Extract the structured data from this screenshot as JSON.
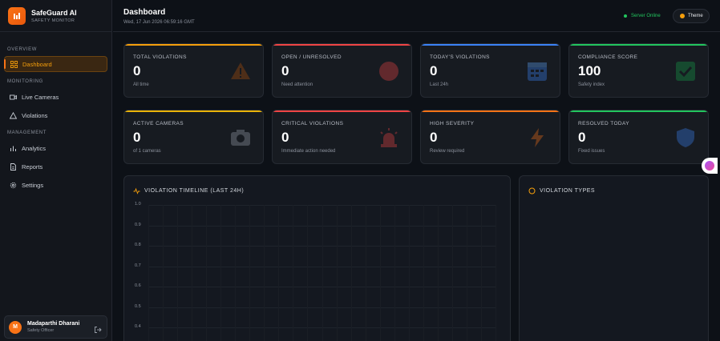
{
  "brand": {
    "name": "SafeGuard AI",
    "subtitle": "SAFETY MONITOR"
  },
  "sidebar": {
    "sections": {
      "overview": "OVERVIEW",
      "monitoring": "MONITORING",
      "management": "MANAGEMENT"
    },
    "items": [
      {
        "label": "Dashboard",
        "icon": "grid-icon",
        "active": true
      },
      {
        "label": "Live Cameras",
        "icon": "video-icon"
      },
      {
        "label": "Violations",
        "icon": "warning-icon"
      },
      {
        "label": "Analytics",
        "icon": "bar-chart-icon"
      },
      {
        "label": "Reports",
        "icon": "document-icon"
      },
      {
        "label": "Settings",
        "icon": "gear-icon"
      }
    ]
  },
  "user": {
    "initial": "M",
    "name": "Madaparthi Dharani",
    "role": "Safety Officer"
  },
  "header": {
    "title": "Dashboard",
    "date": "Wed, 17 Jun 2026 06:59:16 GMT",
    "server_status": "Server Online",
    "theme_label": "Theme"
  },
  "stats": [
    {
      "label": "TOTAL VIOLATIONS",
      "value": "0",
      "sub": "All time",
      "accent": "#f59e0b",
      "icon": "warning-icon"
    },
    {
      "label": "OPEN / UNRESOLVED",
      "value": "0",
      "sub": "Need attention",
      "accent": "#ef4444",
      "icon": "red-circle-icon"
    },
    {
      "label": "TODAY'S VIOLATIONS",
      "value": "0",
      "sub": "Last 24h",
      "accent": "#3b82f6",
      "icon": "calendar-icon"
    },
    {
      "label": "COMPLIANCE SCORE",
      "value": "100",
      "sub": "Safety index",
      "accent": "#22c55e",
      "icon": "check-box-icon"
    },
    {
      "label": "ACTIVE CAMERAS",
      "value": "0",
      "sub": "of 1 cameras",
      "accent": "#eab308",
      "icon": "camera-icon"
    },
    {
      "label": "CRITICAL VIOLATIONS",
      "value": "0",
      "sub": "Immediate action needed",
      "accent": "#ef4444",
      "icon": "siren-icon"
    },
    {
      "label": "HIGH SEVERITY",
      "value": "0",
      "sub": "Review required",
      "accent": "#f97316",
      "icon": "lightning-icon"
    },
    {
      "label": "RESOLVED TODAY",
      "value": "0",
      "sub": "Fixed issues",
      "accent": "#22c55e",
      "icon": "shield-icon"
    }
  ],
  "timeline": {
    "title": "VIOLATION TIMELINE (LAST 24H)",
    "y_ticks": [
      "1.0",
      "0.9",
      "0.8",
      "0.7",
      "0.6",
      "0.5",
      "0.4"
    ]
  },
  "types_panel": {
    "title": "VIOLATION TYPES"
  }
}
